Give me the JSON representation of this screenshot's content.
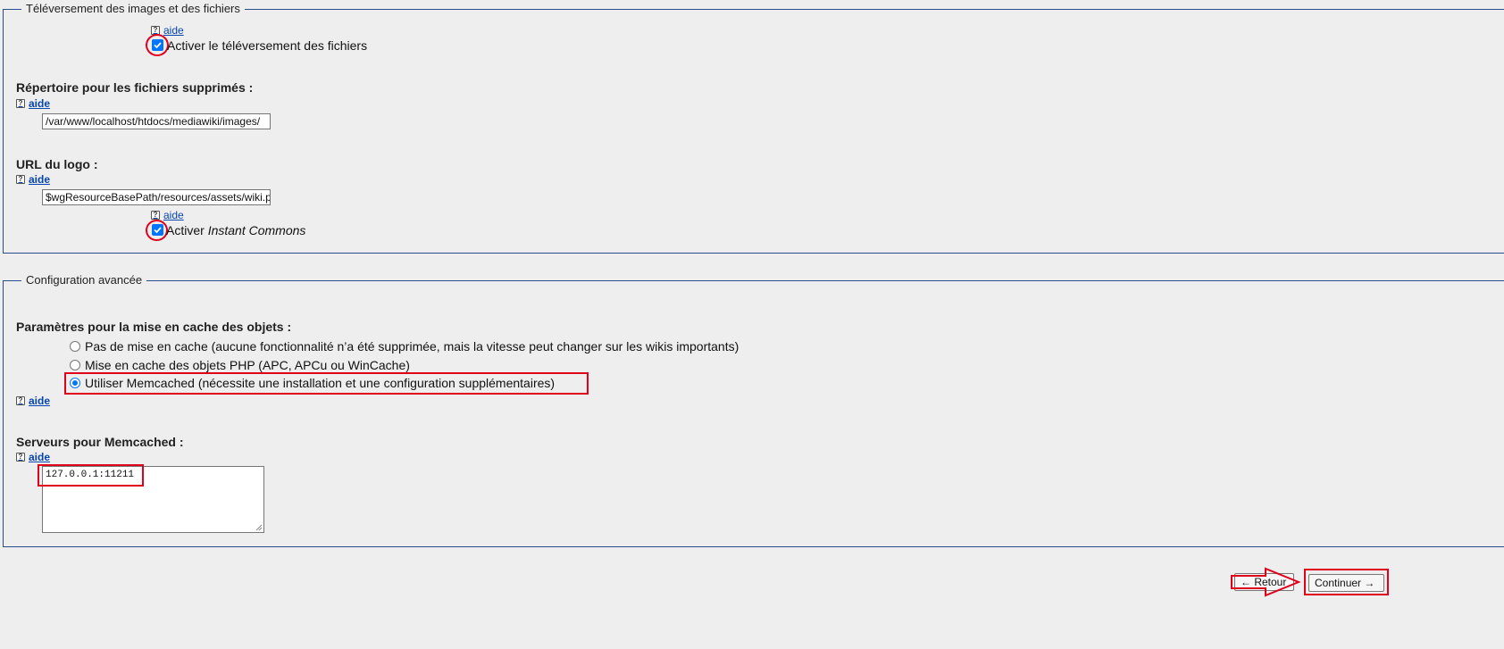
{
  "uploads_section": {
    "legend": "Téléversement des images et des fichiers",
    "help_label": "aide",
    "enable_uploads_label": "Activer le téléversement des fichiers",
    "enable_uploads_checked": true,
    "deleted_dir_label": "Répertoire pour les fichiers supprimés :",
    "deleted_dir_value": "/var/www/localhost/htdocs/mediawiki/images/",
    "logo_url_label": "URL du logo :",
    "logo_url_value": "$wgResourceBasePath/resources/assets/wiki.png",
    "instant_commons_prefix": "Activer ",
    "instant_commons_emphasis": "Instant Commons",
    "instant_commons_checked": true
  },
  "advanced_section": {
    "legend": "Configuration avancée",
    "cache_label": "Paramètres pour la mise en cache des objets :",
    "cache_options": [
      {
        "label": "Pas de mise en cache (aucune fonctionnalité n’a été supprimée, mais la vitesse peut changer sur les wikis importants)",
        "selected": false
      },
      {
        "label": "Mise en cache des objets PHP (APC, APCu ou WinCache)",
        "selected": false
      },
      {
        "label": "Utiliser Memcached (nécessite une installation et une configuration supplémentaires)",
        "selected": true
      }
    ],
    "help_label": "aide",
    "memcached_label": "Serveurs pour Memcached :",
    "memcached_value": "127.0.0.1:11211"
  },
  "buttons": {
    "back": "← Retour",
    "continue": "Continuer →"
  },
  "icons": {
    "help": "help-icon",
    "checkbox_check": "check-icon"
  },
  "colors": {
    "fieldset_border": "#2a4b8d",
    "link": "#0645ad",
    "checkbox_accent": "#0075ff",
    "annotation": "#e0001b",
    "background": "#eeeeee"
  }
}
